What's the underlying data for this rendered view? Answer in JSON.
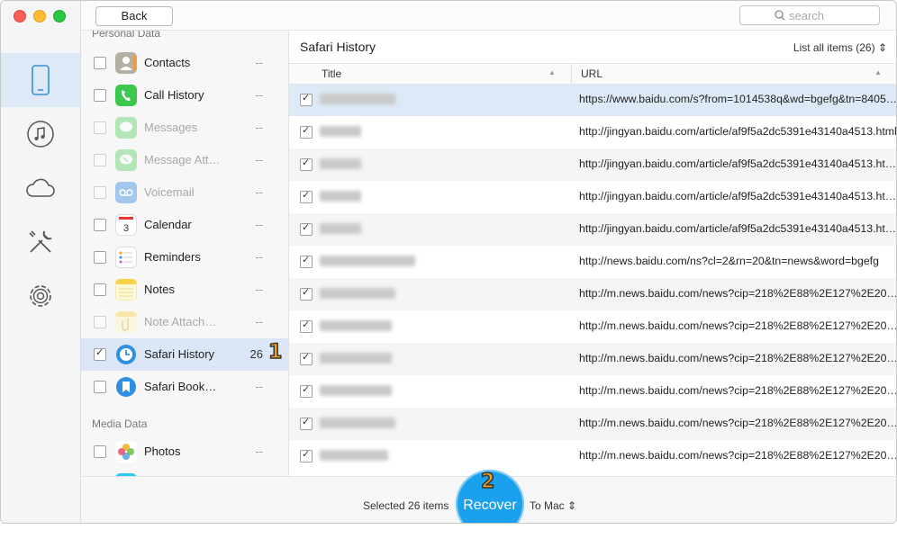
{
  "toolbar": {
    "back_label": "Back",
    "search_placeholder": "search"
  },
  "categories": {
    "personal_title": "Personal Data",
    "media_title": "Media Data",
    "items": [
      {
        "label": "Contacts",
        "count": "--"
      },
      {
        "label": "Call History",
        "count": "--"
      },
      {
        "label": "Messages",
        "count": "--"
      },
      {
        "label": "Message Att…",
        "count": "--"
      },
      {
        "label": "Voicemail",
        "count": "--"
      },
      {
        "label": "Calendar",
        "count": "--"
      },
      {
        "label": "Reminders",
        "count": "--"
      },
      {
        "label": "Notes",
        "count": "--"
      },
      {
        "label": "Note Attach…",
        "count": "--"
      },
      {
        "label": "Safari History",
        "count": "26"
      },
      {
        "label": "Safari Book…",
        "count": "--"
      },
      {
        "label": "Photos",
        "count": "--"
      }
    ]
  },
  "pane": {
    "title": "Safari History",
    "list_selector": "List all items (26)",
    "columns": {
      "title": "Title",
      "url": "URL"
    },
    "rows": [
      {
        "url": "https://www.baidu.com/s?from=1014538q&wd=bgefg&tn=8405…"
      },
      {
        "url": "http://jingyan.baidu.com/article/af9f5a2dc5391e43140a4513.html"
      },
      {
        "url": "http://jingyan.baidu.com/article/af9f5a2dc5391e43140a4513.ht…"
      },
      {
        "url": "http://jingyan.baidu.com/article/af9f5a2dc5391e43140a4513.ht…"
      },
      {
        "url": "http://jingyan.baidu.com/article/af9f5a2dc5391e43140a4513.ht…"
      },
      {
        "url": "http://news.baidu.com/ns?cl=2&rn=20&tn=news&word=bgefg"
      },
      {
        "url": "http://m.news.baidu.com/news?cip=218%2E88%2E127%2E20…"
      },
      {
        "url": "http://m.news.baidu.com/news?cip=218%2E88%2E127%2E20…"
      },
      {
        "url": "http://m.news.baidu.com/news?cip=218%2E88%2E127%2E20…"
      },
      {
        "url": "http://m.news.baidu.com/news?cip=218%2E88%2E127%2E20…"
      },
      {
        "url": "http://m.news.baidu.com/news?cip=218%2E88%2E127%2E20…"
      },
      {
        "url": "http://m.news.baidu.com/news?cip=218%2E88%2E127%2E20…"
      }
    ]
  },
  "bottom": {
    "selected_text": "Selected 26 items",
    "recover_label": "Recover",
    "destination": "To Mac"
  },
  "badges": {
    "step1": "1",
    "step2": "2"
  }
}
